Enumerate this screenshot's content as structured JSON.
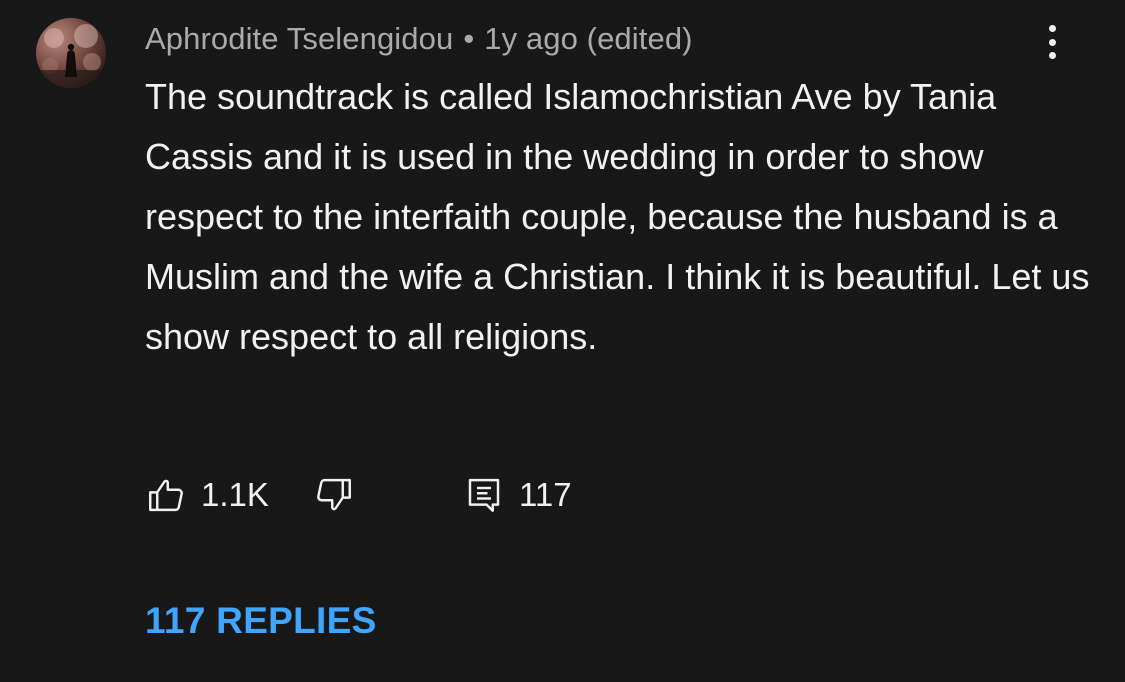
{
  "comment": {
    "author": "Aphrodite Tselengidou",
    "separator": "•",
    "timestamp": "1y ago (edited)",
    "text": "The soundtrack is called Islamochristian Ave by Tania Cassis and it is used in the wedding in order to show respect to the interfaith couple, because the husband is a Muslim and the wife a Christian. I think it is beautiful. Let us show respect to all religions.",
    "actions": {
      "like_icon": "thumbs-up-icon",
      "like_count": "1.1K",
      "dislike_icon": "thumbs-down-icon",
      "reply_icon": "comment-icon",
      "reply_count": "117"
    },
    "replies_label": "117 REPLIES",
    "menu_icon": "more-vertical-icon"
  },
  "colors": {
    "background": "#181818",
    "text": "#f1f1f1",
    "meta": "#aaaaaa",
    "link": "#3ea6ff"
  }
}
